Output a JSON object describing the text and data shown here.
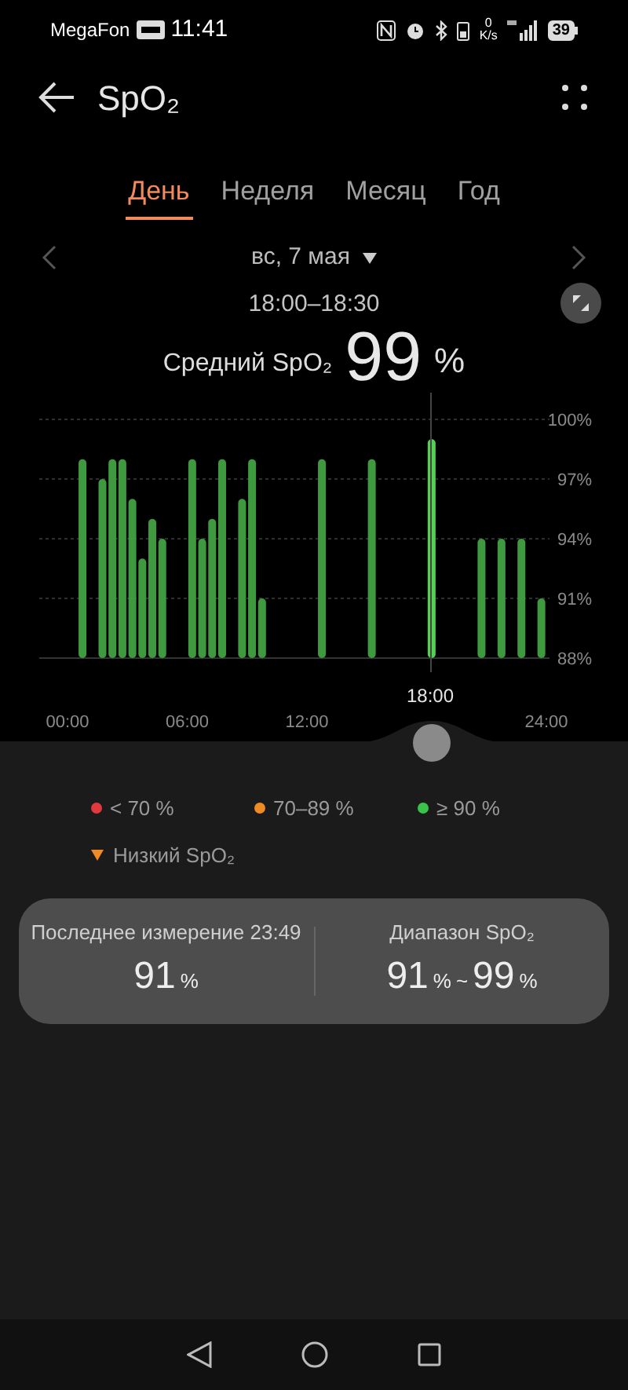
{
  "status_bar": {
    "carrier": "MegaFon",
    "time": "11:41",
    "speed_value": "0",
    "speed_unit": "K/s",
    "battery": "39"
  },
  "header": {
    "title": "SpO₂"
  },
  "tabs": [
    {
      "label": "День",
      "selected": true
    },
    {
      "label": "Неделя",
      "selected": false
    },
    {
      "label": "Месяц",
      "selected": false
    },
    {
      "label": "Год",
      "selected": false
    }
  ],
  "date": "вс, 7 мая",
  "time_range": "18:00–18:30",
  "average": {
    "label": "Средний SpO₂",
    "value": "99",
    "unit": "%"
  },
  "chart_data": {
    "type": "bar",
    "x": [
      0.75,
      1.75,
      2.25,
      2.75,
      3.25,
      3.75,
      4.25,
      4.75,
      6.25,
      6.75,
      7.25,
      7.75,
      8.75,
      9.25,
      9.75,
      12.75,
      15.25,
      18.25,
      20.75,
      21.75,
      22.75,
      23.75
    ],
    "series": [
      {
        "color": "#3f993f",
        "values": [
          98,
          97,
          98,
          98,
          96,
          93,
          95,
          94,
          98,
          94,
          95,
          98,
          96,
          98,
          91,
          98,
          98,
          null,
          94,
          94,
          94,
          91
        ]
      },
      {
        "color": "#52d152",
        "values": [
          null,
          null,
          null,
          null,
          null,
          null,
          null,
          null,
          null,
          null,
          null,
          null,
          null,
          null,
          null,
          null,
          null,
          99,
          null,
          null,
          null,
          null
        ]
      }
    ],
    "grid": true,
    "xlim": [
      0,
      24
    ],
    "ylim": [
      88,
      100
    ],
    "xticks": [
      {
        "value": 0,
        "label": "00:00"
      },
      {
        "value": 6,
        "label": "06:00"
      },
      {
        "value": 12,
        "label": "12:00"
      },
      {
        "value": 24,
        "label": "24:00"
      }
    ],
    "yticks": [
      {
        "value": 100,
        "label": "100%"
      },
      {
        "value": 97,
        "label": "97%"
      },
      {
        "value": 94,
        "label": "94%"
      },
      {
        "value": 91,
        "label": "91%"
      },
      {
        "value": 88,
        "label": "88%"
      }
    ]
  },
  "selection": {
    "label": "18:00"
  },
  "legend": [
    {
      "label": "< 70 %",
      "color": "#e0393e"
    },
    {
      "label": "70–89 %",
      "color": "#f08a24"
    },
    {
      "label": "≥ 90 %",
      "color": "#3bc24a"
    }
  ],
  "low_marker": {
    "label": "Низкий SpO₂"
  },
  "summary": {
    "last": {
      "label": "Последнее измерение 23:49",
      "value": "91",
      "unit": "%"
    },
    "range": {
      "label": "Диапазон SpO₂",
      "low": "91",
      "low_unit": "%",
      "separator": "~",
      "high": "99",
      "high_unit": "%"
    }
  }
}
